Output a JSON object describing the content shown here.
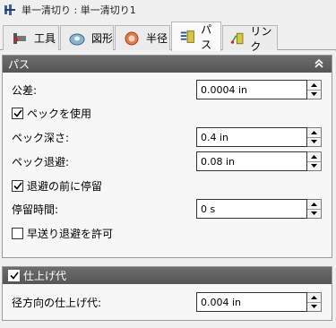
{
  "title": "単一清切り : 単一清切り1",
  "tabs": [
    {
      "label": "工具",
      "icon": "tool-icon"
    },
    {
      "label": "図形",
      "icon": "geometry-icon"
    },
    {
      "label": "半径",
      "icon": "radius-icon"
    },
    {
      "label": "パス",
      "icon": "passes-icon"
    },
    {
      "label": "リンク",
      "icon": "linking-icon"
    }
  ],
  "passes": {
    "header": "パス",
    "tolerance_label": "公差:",
    "tolerance_value": "0.0004 in",
    "use_pecking_label": "ペックを使用",
    "use_pecking_checked": true,
    "peck_depth_label": "ペック深さ:",
    "peck_depth_value": "0.4 in",
    "peck_retract_label": "ペック退避:",
    "peck_retract_value": "0.08 in",
    "dwell_before_retract_label": "退避の前に停留",
    "dwell_before_retract_checked": true,
    "dwell_time_label": "停留時間:",
    "dwell_time_value": "0 s",
    "allow_rapid_retract_label": "早送り退避を許可",
    "allow_rapid_retract_checked": false
  },
  "stock_to_leave": {
    "header": "仕上げ代",
    "checked": true,
    "radial_label": "径方向の仕上げ代:",
    "radial_value": "0.004 in"
  }
}
